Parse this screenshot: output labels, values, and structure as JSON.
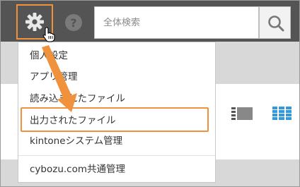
{
  "header": {
    "settings_icon": "gear-icon",
    "help_icon": "question-icon",
    "search": {
      "placeholder": "全体検索",
      "value": ""
    },
    "search_icon": "magnifier-icon"
  },
  "menu": {
    "items": [
      {
        "label": "個人設定"
      },
      {
        "label": "アプリ管理"
      },
      {
        "label": "読み込まれたファイル"
      },
      {
        "label": "出力されたファイル"
      },
      {
        "label": "kintoneシステム管理"
      },
      {
        "label": "cybozu.com共通管理"
      }
    ]
  },
  "view_toggle": {
    "list_icon": "list-view-icon",
    "grid_icon": "grid-view-icon"
  },
  "colors": {
    "header": "#545454",
    "highlight": "#f0923b",
    "accent": "#3498db"
  }
}
